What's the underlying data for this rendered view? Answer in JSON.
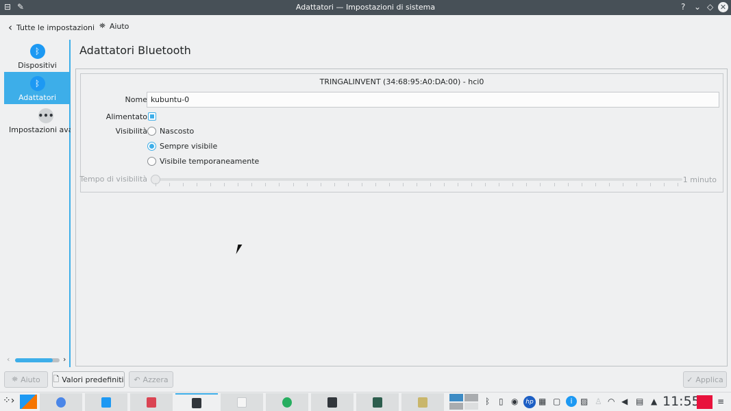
{
  "window": {
    "title": "Adattatori — Impostazioni di sistema"
  },
  "toolbar": {
    "back_label": "Tutte le impostazioni",
    "help_label": "Aiuto"
  },
  "sidebar": {
    "items": [
      {
        "label": "Dispositivi",
        "icon": "bluetooth-icon"
      },
      {
        "label": "Adattatori",
        "icon": "bluetooth-icon",
        "selected": true
      },
      {
        "label": "Impostazioni avanzate",
        "icon": "more-icon"
      }
    ],
    "scroll_position": 0.85
  },
  "page": {
    "title": "Adattatori Bluetooth"
  },
  "adapter": {
    "header": "TRINGALINVENT (34:68:95:A0:DA:00) - hci0",
    "name_label": "Nome",
    "name_value": "kubuntu-0",
    "powered_label": "Alimentato",
    "powered": true,
    "visibility_label": "Visibilità",
    "options": [
      "Nascosto",
      "Sempre visibile",
      "Visibile temporaneamente"
    ],
    "selected_option": "Sempre visibile",
    "timeout_label": "Tempo di visibilità",
    "timeout_value_label": "1 minuto",
    "timeout_fraction": 0
  },
  "buttons": {
    "help": "Aiuto",
    "defaults": "Valori predefiniti",
    "reset": "Azzera",
    "apply": "Applica"
  },
  "taskbar": {
    "clock": "11:55"
  },
  "colors": {
    "accent": "#3daee9",
    "titlebar": "#475057"
  }
}
